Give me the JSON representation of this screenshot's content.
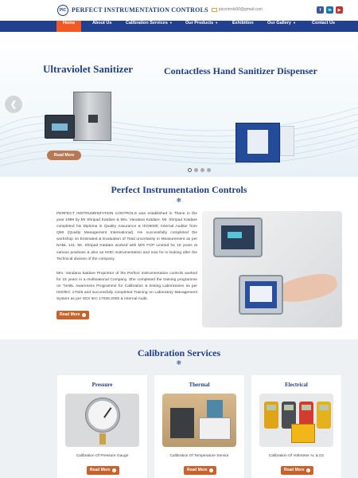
{
  "header": {
    "logo_text": "PIC",
    "brand": "PERFECT INSTRUMENTATION CONTROLS",
    "email": "picontrols99@gmail.com",
    "social": [
      "f",
      "in",
      "▶"
    ]
  },
  "nav": {
    "items": [
      {
        "label": "Home",
        "active": true
      },
      {
        "label": "About Us"
      },
      {
        "label": "Calibration Services",
        "dropdown": true
      },
      {
        "label": "Our Products",
        "dropdown": true
      },
      {
        "label": "Exhibition"
      },
      {
        "label": "Our Gallery",
        "dropdown": true
      },
      {
        "label": "Contact Us"
      }
    ]
  },
  "slider": {
    "title_left": "Ultraviolet Sanitizer",
    "title_right": "Contactless Hand Sanitizer Dispenser",
    "read_more": "Read More",
    "prev_arrow": "❮",
    "dots": 4,
    "active_dot": 0
  },
  "about": {
    "title": "Perfect Instrumentation Controls",
    "divider": "❄",
    "para1": "PERFECT INSTRUMENTATION CONTROLS was established in Thane in the year 1999 by Mr Shripad Katdare & Mrs. Vandana Katdare. Mr. Shripad Katdare completed his Diploma in Quality Assurance & ISO9000; Internal Auditor from QMI (Quality Management International). He successfully completed the workshop on Estimated & Evaluation of Total uncertainty in Measurement as per NABL 141. Mr. Shripad Katdare worked with M/S FGP Limited for 15 years at various positions & also as HOD Instrumentation and now he is looking after the Technical division of the company.",
    "para2": "Mrs. Vandana katdare Proprietor of the Perfect Instrumentation controls worked for 15 years in a multinational Company. She completed the training programme on \"NABL Awareness Programme for Calibration & testing Laboratories as per ISO/IEC 17025 and successfully completed Training on Laboratory Management System as per ISO/ IEC 17025:2005 & Internal Audit.",
    "read_more": "Read More"
  },
  "services": {
    "title": "Calibration Services",
    "divider": "❄",
    "cards": [
      {
        "title": "Pressure",
        "caption": "Calibration Of Pressure Gauge",
        "read_more": "Read More"
      },
      {
        "title": "Thermal",
        "caption": "Calibration Of Temperature Sensor",
        "read_more": "Read More"
      },
      {
        "title": "Electrical",
        "caption": "Calibration Of Voltmeter Ac & Dc",
        "read_more": "Read More"
      }
    ]
  },
  "colors": {
    "brand_blue": "#1f3f86",
    "nav_blue": "#23408e",
    "accent_orange": "#f15a24",
    "button_brown": "#c8632e"
  }
}
